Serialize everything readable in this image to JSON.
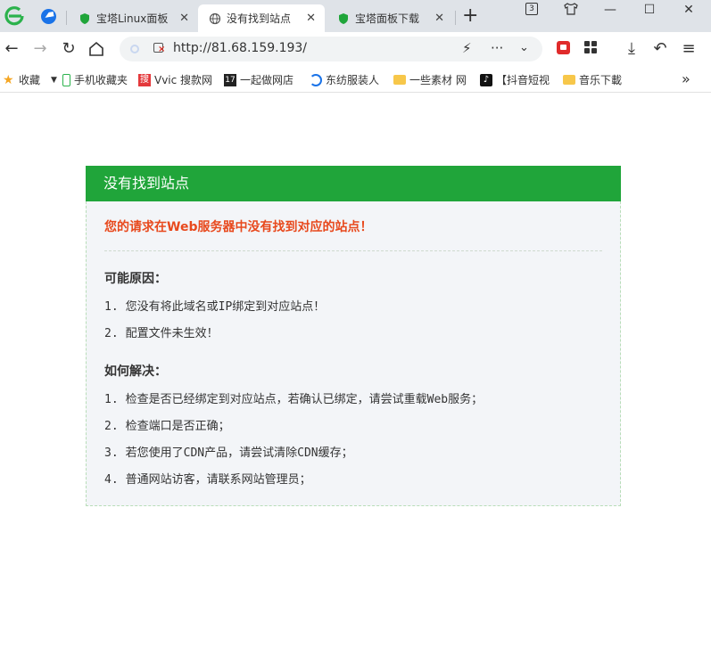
{
  "browser": {
    "tabs": [
      {
        "title": "宝塔Linux面板",
        "active": false
      },
      {
        "title": "没有找到站点",
        "active": true
      },
      {
        "title": "宝塔面板下载",
        "active": false
      }
    ],
    "tab_count": "3",
    "url": "http://81.68.159.193/"
  },
  "bookmarks": [
    {
      "label": "收藏"
    },
    {
      "label": "手机收藏夹"
    },
    {
      "label": "Vvic 搜款网"
    },
    {
      "label": "一起做网店"
    },
    {
      "label": "东纺服装人"
    },
    {
      "label": "一些素材 网"
    },
    {
      "label": "【抖音短视"
    },
    {
      "label": "音乐下載"
    }
  ],
  "page": {
    "header": "没有找到站点",
    "error": "您的请求在Web服务器中没有找到对应的站点！",
    "reasons_title": "可能原因：",
    "reasons": [
      {
        "num": "1.",
        "text": "您没有将此域名或IP绑定到对应站点！"
      },
      {
        "num": "2.",
        "text": "配置文件未生效！"
      }
    ],
    "solutions_title": "如何解决：",
    "solutions": [
      {
        "num": "1.",
        "text": "检查是否已经绑定到对应站点，若确认已绑定，请尝试重载Web服务；"
      },
      {
        "num": "2.",
        "text": "检查端口是否正确；"
      },
      {
        "num": "3.",
        "text": "若您使用了CDN产品，请尝试清除CDN缓存；"
      },
      {
        "num": "4.",
        "text": "普通网站访客，请联系网站管理员；"
      }
    ]
  },
  "colors": {
    "header_green": "#20a53a",
    "error_red": "#e8491d"
  }
}
